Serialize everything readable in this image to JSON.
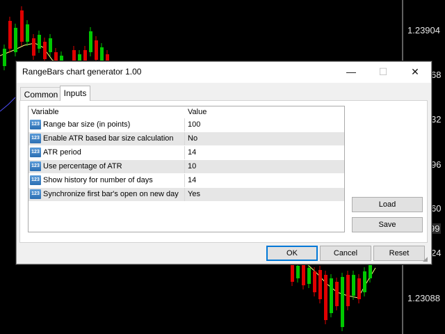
{
  "chart": {
    "price_labels": [
      "1.23904",
      "68",
      "32",
      "96",
      "60",
      "99",
      "24",
      "1.23088"
    ]
  },
  "dialog": {
    "title": "RangeBars chart generator 1.00",
    "minimize_glyph": "—",
    "maximize_glyph": "☐",
    "close_glyph": "✕",
    "tabs": [
      {
        "label": "Common",
        "active": false
      },
      {
        "label": "Inputs",
        "active": true
      }
    ],
    "table": {
      "headers": {
        "variable": "Variable",
        "value": "Value"
      },
      "icon_text": "123",
      "rows": [
        {
          "variable": "Range bar size (in points)",
          "value": "100"
        },
        {
          "variable": "Enable ATR based bar size calculation",
          "value": "No"
        },
        {
          "variable": "ATR period",
          "value": "14"
        },
        {
          "variable": "Use percentage of ATR",
          "value": "10"
        },
        {
          "variable": "Show history for number of days",
          "value": "14"
        },
        {
          "variable": "Synchronize first bar's open on new day",
          "value": "Yes"
        }
      ]
    },
    "load_label": "Load",
    "save_label": "Save",
    "ok_label": "OK",
    "cancel_label": "Cancel",
    "reset_label": "Reset"
  },
  "colors": {
    "bull": "#00c800",
    "bear": "#e00000",
    "ma": "#ffff80",
    "accent": "#0078d7"
  }
}
